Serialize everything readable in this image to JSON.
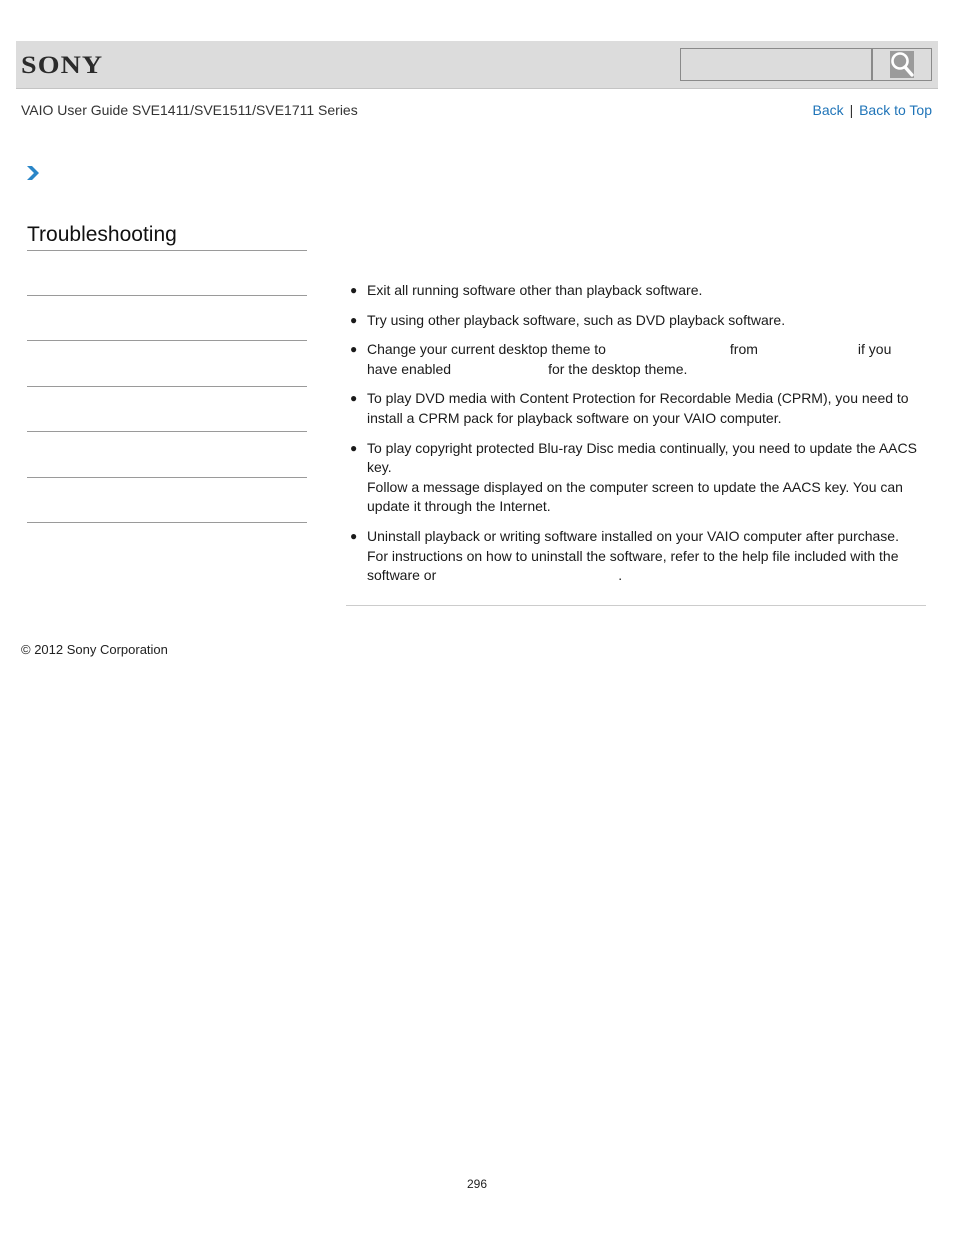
{
  "header": {
    "logo_text": "SONY",
    "search": {
      "placeholder": "",
      "value": "",
      "button_icon": "search-icon"
    }
  },
  "nav": {
    "guide_title": "VAIO User Guide SVE1411/SVE1511/SVE1711 Series",
    "back_label": "Back",
    "separator": "|",
    "back_to_top_label": "Back to Top"
  },
  "breadcrumb": {
    "icon": "chevron-right-icon"
  },
  "sidebar": {
    "title": "Troubleshooting",
    "items": [
      {
        "label": ""
      },
      {
        "label": ""
      },
      {
        "label": ""
      },
      {
        "label": ""
      },
      {
        "label": ""
      },
      {
        "label": ""
      }
    ]
  },
  "main": {
    "bullets": [
      {
        "lines": [
          "Exit all running software other than playback software."
        ]
      },
      {
        "lines": [
          "Try using other playback software, such as DVD playback software."
        ]
      },
      {
        "segments": {
          "a": "Change your current desktop theme to",
          "b": "from",
          "c": "if you",
          "d": "have enabled",
          "e": "for the desktop theme."
        }
      },
      {
        "lines": [
          "To play DVD media with Content Protection for Recordable Media (CPRM), you need to",
          "install a CPRM pack for playback software on your VAIO computer."
        ]
      },
      {
        "lines": [
          "To play copyright protected Blu-ray Disc media continually, you need to update the AACS",
          "key.",
          "Follow a message displayed on the computer screen to update the AACS key. You can",
          "update it through the Internet."
        ]
      },
      {
        "lines": [
          "Uninstall playback or writing software installed on your VAIO computer after purchase.",
          "For instructions on how to uninstall the software, refer to the help file included with the"
        ],
        "tail": {
          "a": "software or",
          "b": "."
        }
      }
    ]
  },
  "footer": {
    "copyright": "© 2012 Sony Corporation",
    "page_number": "296"
  }
}
